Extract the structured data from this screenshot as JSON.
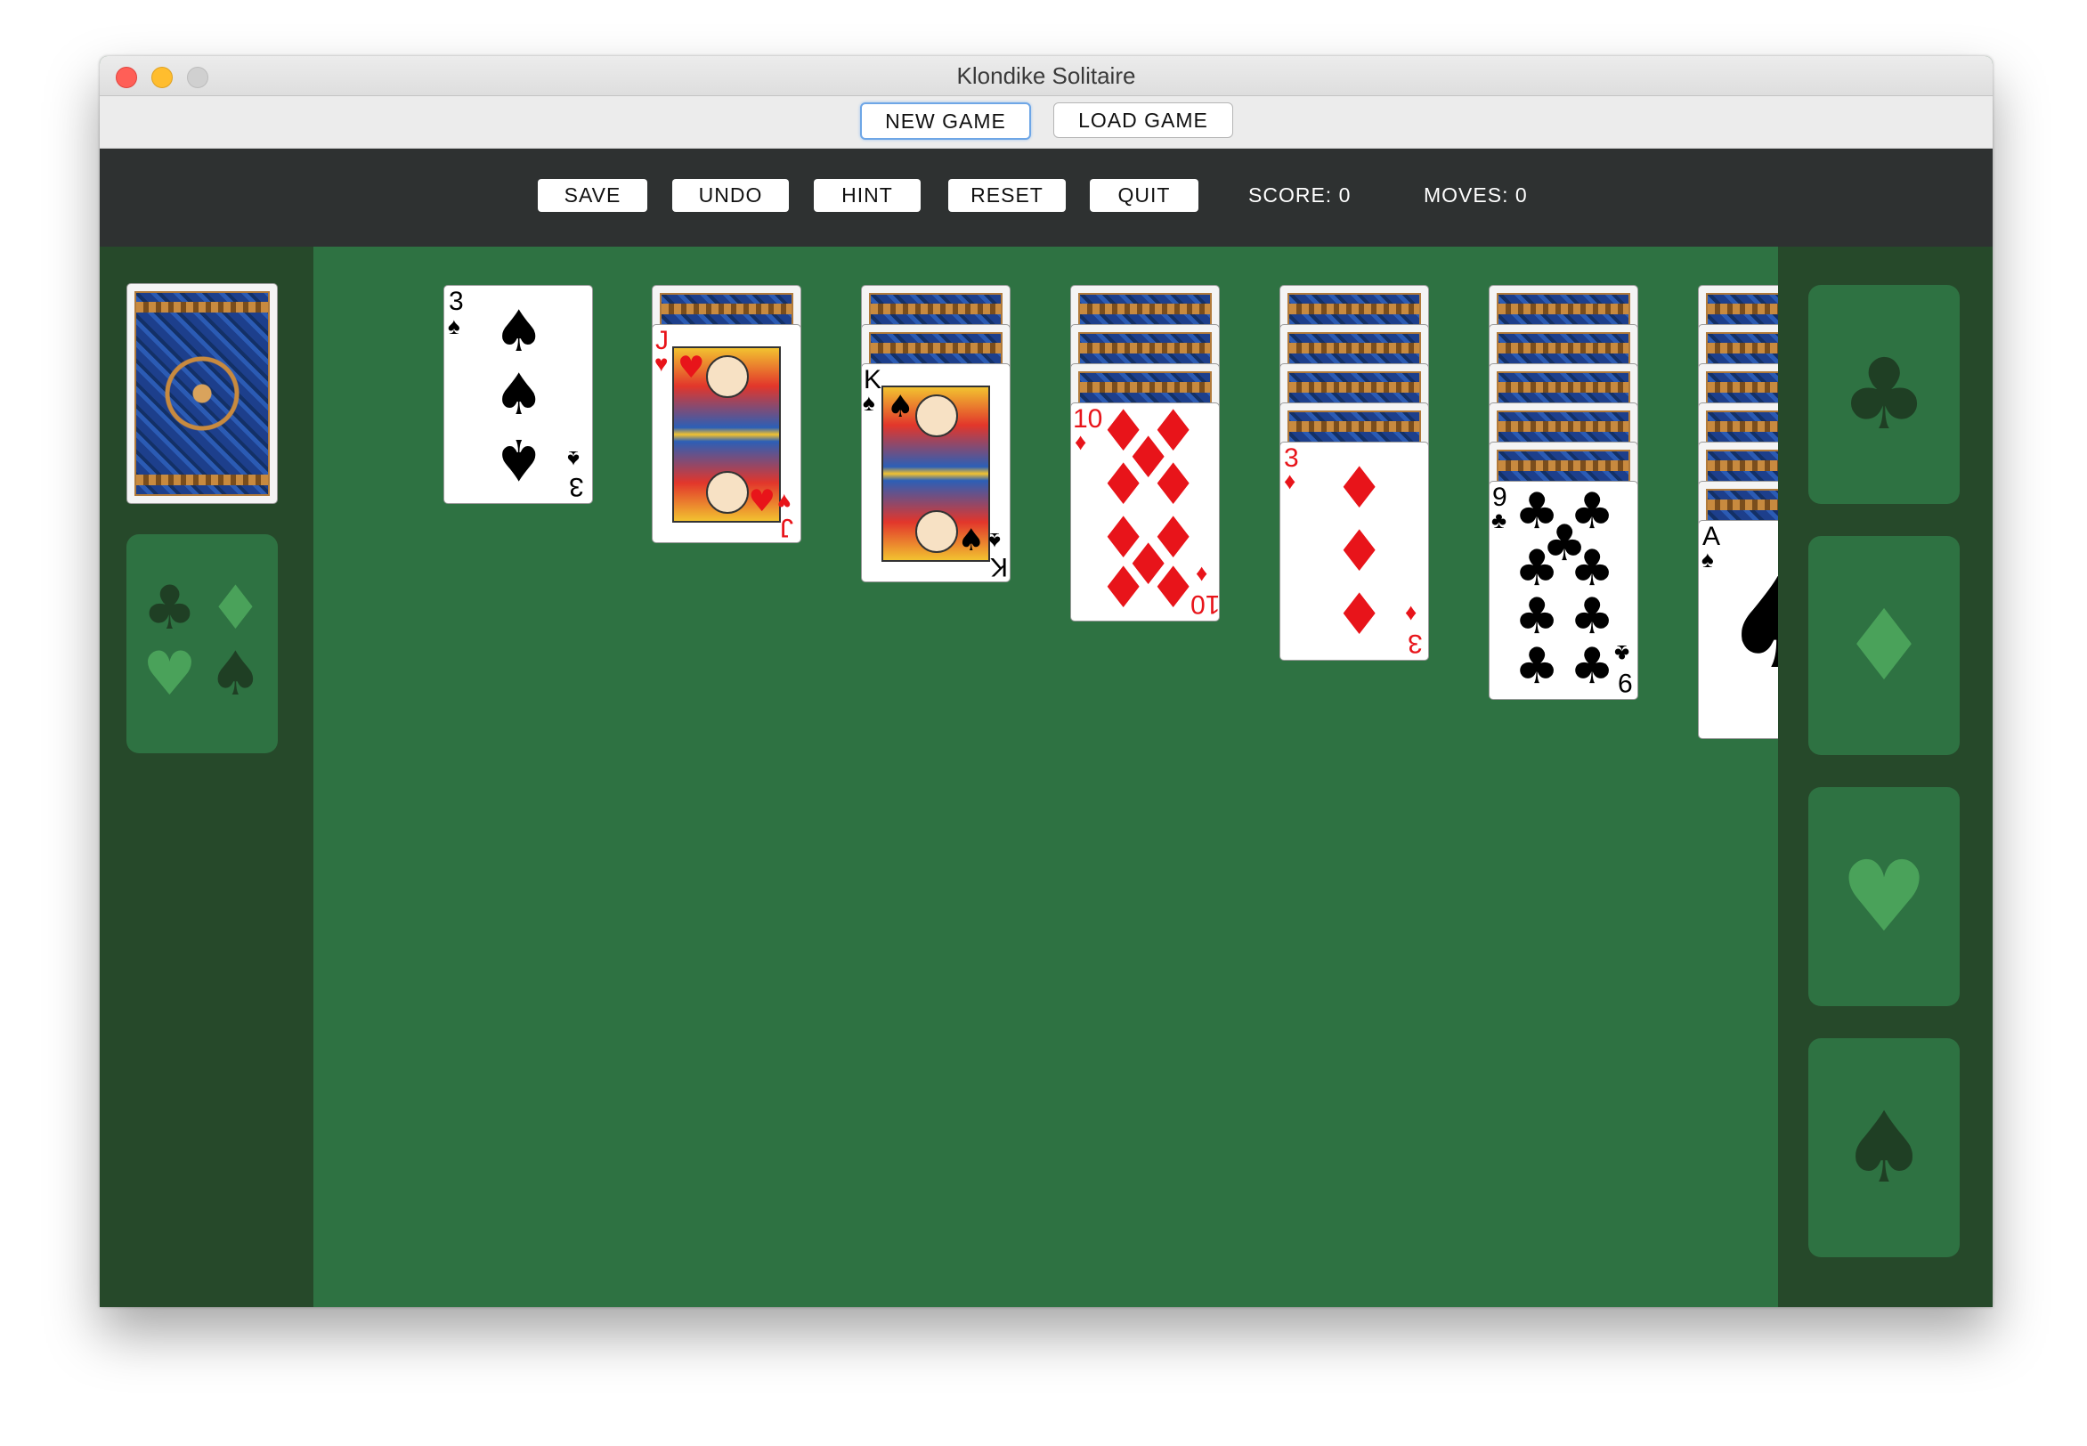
{
  "window": {
    "title": "Klondike Solitaire"
  },
  "game_menu": {
    "new_game": "NEW GAME",
    "load_game": "LOAD GAME"
  },
  "toolbar": {
    "save": "SAVE",
    "undo": "UNDO",
    "hint": "HINT",
    "reset": "RESET",
    "quit": "QUIT",
    "score": "SCORE: 0",
    "moves": "MOVES: 0"
  },
  "stock": {
    "face_down": true
  },
  "waste": {
    "empty_suits": [
      "clubs",
      "diamonds",
      "hearts",
      "spades"
    ]
  },
  "tableau": {
    "col1": {
      "hidden": 0,
      "top": {
        "rank": "3",
        "suit": "♠",
        "color": "black"
      }
    },
    "col2": {
      "hidden": 1,
      "top": {
        "rank": "J",
        "suit": "♥",
        "color": "red"
      }
    },
    "col3": {
      "hidden": 2,
      "top": {
        "rank": "K",
        "suit": "♠",
        "color": "black"
      }
    },
    "col4": {
      "hidden": 3,
      "top": {
        "rank": "10",
        "suit": "♦",
        "color": "red"
      }
    },
    "col5": {
      "hidden": 4,
      "top": {
        "rank": "3",
        "suit": "♦",
        "color": "red"
      }
    },
    "col6": {
      "hidden": 5,
      "top": {
        "rank": "9",
        "suit": "♣",
        "color": "black"
      }
    },
    "col7": {
      "hidden": 6,
      "top": {
        "rank": "A",
        "suit": "♠",
        "color": "black"
      }
    }
  },
  "foundations": [
    {
      "suit": "clubs",
      "icon": "club-icon"
    },
    {
      "suit": "diamonds",
      "icon": "diamond-icon"
    },
    {
      "suit": "hearts",
      "icon": "heart-icon"
    },
    {
      "suit": "spades",
      "icon": "spade-icon"
    }
  ],
  "colors": {
    "felt": "#2e7242",
    "felt_dark": "#26492a",
    "toolbar": "#2e3131",
    "red_suit": "#e8141a"
  }
}
